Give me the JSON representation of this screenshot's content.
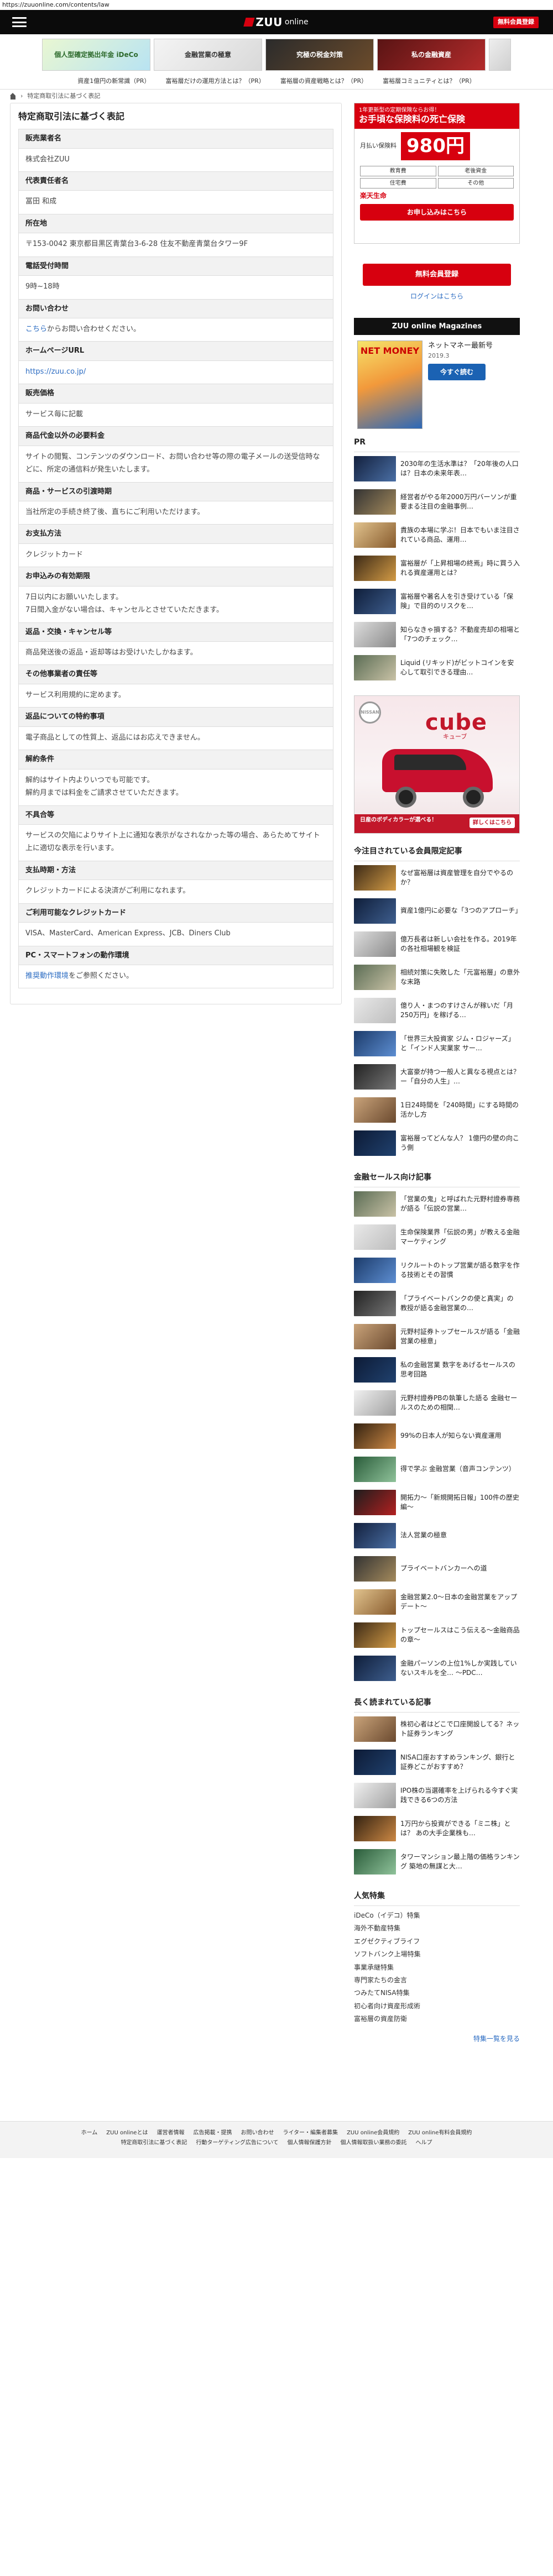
{
  "urlbar": "https://zuuonline.com/contents/law",
  "header": {
    "logo_text": "ZUU",
    "logo_sub": "online",
    "register_label": "無料会員登録"
  },
  "banners": [
    {
      "label": "個人型確定拠出年金 iDeCo"
    },
    {
      "label": "金融営業の極意"
    },
    {
      "label": "究極の税金対策"
    },
    {
      "label": "私の金融資産"
    },
    {
      "label": ""
    }
  ],
  "pr_links": [
    "資産1億円の新常識（PR）",
    "富裕層だけの運用方法とは？（PR）",
    "富裕層の資産戦略とは？（PR）",
    "富裕層コミュニティとは？（PR）"
  ],
  "breadcrumb": {
    "current": "特定商取引法に基づく表記"
  },
  "main": {
    "title": "特定商取引法に基づく表記",
    "rows": [
      {
        "h": "販売業者名",
        "v": "株式会社ZUU"
      },
      {
        "h": "代表責任者名",
        "v": "冨田 和成"
      },
      {
        "h": "所在地",
        "v": "〒153-0042 東京都目黒区青葉台3-6-28 住友不動産青葉台タワー9F"
      },
      {
        "h": "電話受付時間",
        "v": "9時~18時"
      },
      {
        "h": "お問い合わせ",
        "v": "",
        "link": "こちら",
        "rest": "からお問い合わせください。"
      },
      {
        "h": "ホームページURL",
        "v": "",
        "link": "https://zuu.co.jp/"
      },
      {
        "h": "販売価格",
        "v": "サービス毎に記載"
      },
      {
        "h": "商品代金以外の必要料金",
        "v": "サイトの閲覧、コンテンツのダウンロード、お問い合わせ等の際の電子メールの送受信時などに、所定の通信料が発生いたします。"
      },
      {
        "h": "商品・サービスの引渡時期",
        "v": "当社所定の手続き終了後、直ちにご利用いただけます。"
      },
      {
        "h": "お支払方法",
        "v": "クレジットカード"
      },
      {
        "h": "お申込みの有効期限",
        "v": "7日以内にお願いいたします。\n7日間入金がない場合は、キャンセルとさせていただきます。"
      },
      {
        "h": "返品・交換・キャンセル等",
        "v": "商品発送後の返品・返却等はお受けいたしかねます。"
      },
      {
        "h": "その他事業者の責任等",
        "v": "サービス利用規約に定めます。"
      },
      {
        "h": "返品についての特約事項",
        "v": "電子商品としての性質上、返品にはお応えできません。"
      },
      {
        "h": "解約条件",
        "v": "解約はサイト内よりいつでも可能です。\n解約月までは料金をご請求させていただきます。"
      },
      {
        "h": "不具合等",
        "v": "サービスの欠陥によりサイト上に通知な表示がなされなかった等の場合、あらためてサイト上に適切な表示を行います。"
      },
      {
        "h": "支払時期・方法",
        "v": "クレジットカードによる決済がご利用になれます。"
      },
      {
        "h": "ご利用可能なクレジットカード",
        "v": "VISA、MasterCard、American Express、JCB、Diners Club"
      },
      {
        "h": "PC・スマートフォンの動作環境",
        "v": "",
        "link": "推奨動作環境",
        "rest": "をご参照ください。"
      }
    ]
  },
  "side": {
    "ad_insurance": {
      "note": "1年更新型の定期保険ならお得！",
      "headline": "お手頃な保険料の死亡保険",
      "price_label": "月払い保険料",
      "price": "980円",
      "grid": [
        "教育費",
        "老後資金",
        "住宅費",
        "その他"
      ],
      "cta": "お申し込みはこちら",
      "brand": "楽天生命"
    },
    "free_register": "無料会員登録",
    "login": "ログインはこちら",
    "magazines": {
      "title": "ZUU online Magazines",
      "cover": "NET MONEY",
      "mag_title": "ネットマネー最新号",
      "mag_date": "2019.3",
      "buy": "今すぐ読む"
    },
    "pr": {
      "title": "PR",
      "items": [
        "2030年の生活水準は？「20年後の人口は？日本の未来年表…",
        "経営者がやる年2000万円バーソンが重要まる注目の金融事例…",
        "貴族の本場に学ぶ！日本でもいま注目されている商品、運用…",
        "富裕層が「上昇相場の終焉」時に買う入れる資産運用とは？",
        "富裕層や著名人を引き受けている「保険」で目的のリスクを…",
        "知らなきゃ損する？不動産売却の相場と「7つのチェック…",
        "Liquid (リキッド)がビットコインを安心して取引できる理由…"
      ]
    },
    "ad_car": {
      "maker": "NISSAN",
      "name": "cube",
      "sub": "キューブ",
      "bar": "日産のボディカラーが選べる！",
      "more": "詳しくはこちら"
    },
    "popular": {
      "title": "今注目されている会員限定記事",
      "items": [
        "なぜ富裕層は資産管理を自分でやるのか？",
        "資産1億円に必要な「3つのアプローチ」",
        "億万長者は新しい会社を作る。2019年の各社相場観を検証",
        "相続対策に失敗した「元富裕層」の意外な末路",
        "億り人・まつのすけさんが稼いだ「月250万円」を稼げる…",
        "「世界三大投資家 ジム・ロジャーズ」と「インド人実業家 サー…",
        "大富豪が持つ一般人と異なる視点とは？ー「自分の人生」…",
        "1日24時間を「240時間」にする時間の活かし方",
        "富裕層ってどんな人？ 1億円の壁の向こう側"
      ]
    },
    "sales": {
      "title": "金融セールス向け記事",
      "items": [
        "「営業の鬼」と呼ばれた元野村證券専務が語る「伝説の営業…",
        "生命保険業界「伝説の男」が教える金融マーケティング",
        "リクルートのトップ営業が語る数字を作る技術とその習慣",
        "「プライベートバンクの使と真実」の教授が語る金融営業の…",
        "元野村証券トップセールスが語る「金融営業の極意」",
        "私の金融営業 数字をあげるセールスの思考回路",
        "元野村證券PBの執筆した語る 金融セールスのための相関…",
        "99%の日本人が知らない資産運用",
        "得で学ぶ 金融営業（音声コンテンツ）",
        "開拓力〜「新規開拓日報」100件の歴史編〜",
        "法人営業の極意",
        "プライベートバンカーへの道",
        "金融営業2.0〜日本の金融営業をアップデート〜",
        "トップセールスはこう伝える〜金融商品の章〜",
        "金融パーソンの上位1%しか実践していないスキルを全… 〜PDC…"
      ]
    },
    "longread": {
      "title": "長く読まれている記事",
      "items": [
        "株初心者はどこで口座開設してる？ネット証券ランキング",
        "NISA口座おすすめランキング、銀行と証券どこがおすすめ？",
        "IPO株の当選確率を上げられる今すぐ実践できる6つの方法",
        "1万円から投資ができる「ミニ株」とは？ あの大手企業株も…",
        "タワーマンション最上階の価格ランキング 築地の無謀と大…"
      ]
    },
    "features": {
      "title": "人気特集",
      "items": [
        "iDeCo（イデコ）特集",
        "海外不動産特集",
        "エグゼクティブライフ",
        "ソフトバンク上場特集",
        "事業承継特集",
        "専門家たちの金言",
        "つみたてNISA特集",
        "初心者向け資産形成術",
        "富裕層の資産防衛"
      ],
      "more": "特集一覧を見る"
    }
  },
  "footer": {
    "row1": [
      "ホーム",
      "ZUU onlineとは",
      "運営者情報",
      "広告掲載・提携",
      "お問い合わせ",
      "ライター・編集者募集",
      "ZUU online会員規約",
      "ZUU online有料会員規約"
    ],
    "row2": [
      "特定商取引法に基づく表記",
      "行動ターゲティング広告について",
      "個人情報保護方針",
      "個人情報取扱い業務の委託",
      "ヘルプ"
    ]
  }
}
